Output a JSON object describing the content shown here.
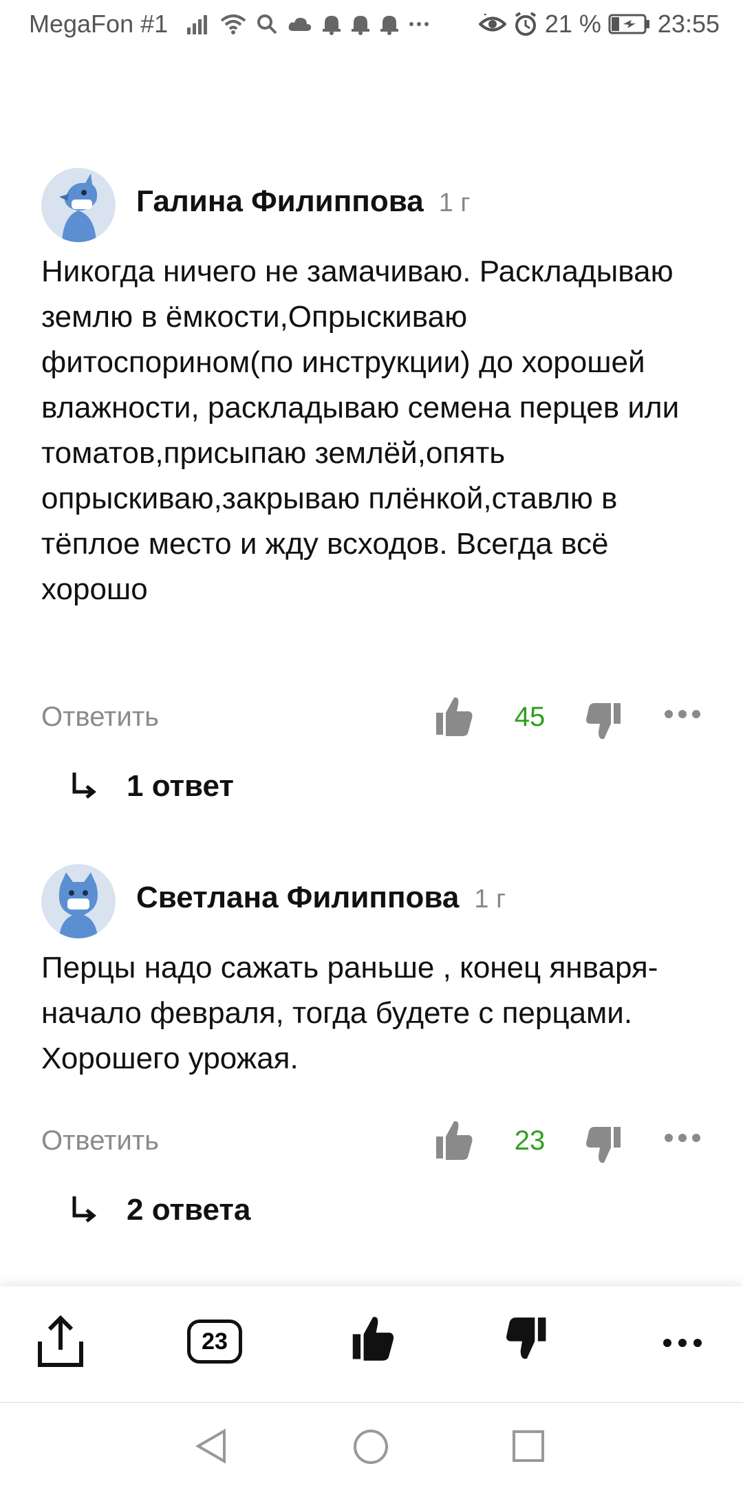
{
  "status_bar": {
    "carrier": "MegaFon #1",
    "battery": "21 %",
    "time": "23:55"
  },
  "comments": [
    {
      "author": "Галина Филиппова",
      "time": "1 г",
      "text": "Никогда ничего не замачиваю. Раскладываю землю в ёмкости,Опрыскиваю фитоспорином(по инструкции) до хорошей влажности, раскладываю семена перцев или томатов,присыпаю землёй,опять опрыскиваю,закрываю плёнкой,ставлю в тёплое место и жду всходов. Всегда всё хорошо",
      "reply_label": "Ответить",
      "likes": "45",
      "answers_label": "1 ответ"
    },
    {
      "author": "Светлана Филиппова",
      "time": "1 г",
      "text": "Перцы надо сажать раньше , конец января-начало февраля, тогда будете с перцами. Хорошего урожая.",
      "reply_label": "Ответить",
      "likes": "23",
      "answers_label": "2 ответа"
    }
  ],
  "toolbar": {
    "comments_count": "23"
  },
  "colors": {
    "like_count": "#2f9e1f",
    "muted_text": "#8a8a8a",
    "avatar_bg": "#d9e3ef",
    "avatar_figure": "#5b8fd1"
  },
  "icons": [
    "signal-icon",
    "wifi-icon",
    "search-icon",
    "cloud-icon",
    "bell-icon",
    "eye-icon",
    "alarm-icon",
    "battery-icon",
    "thumb-up-icon",
    "thumb-down-icon",
    "more-icon",
    "reply-arrow-icon",
    "share-icon",
    "back-icon",
    "home-icon",
    "recents-icon"
  ]
}
